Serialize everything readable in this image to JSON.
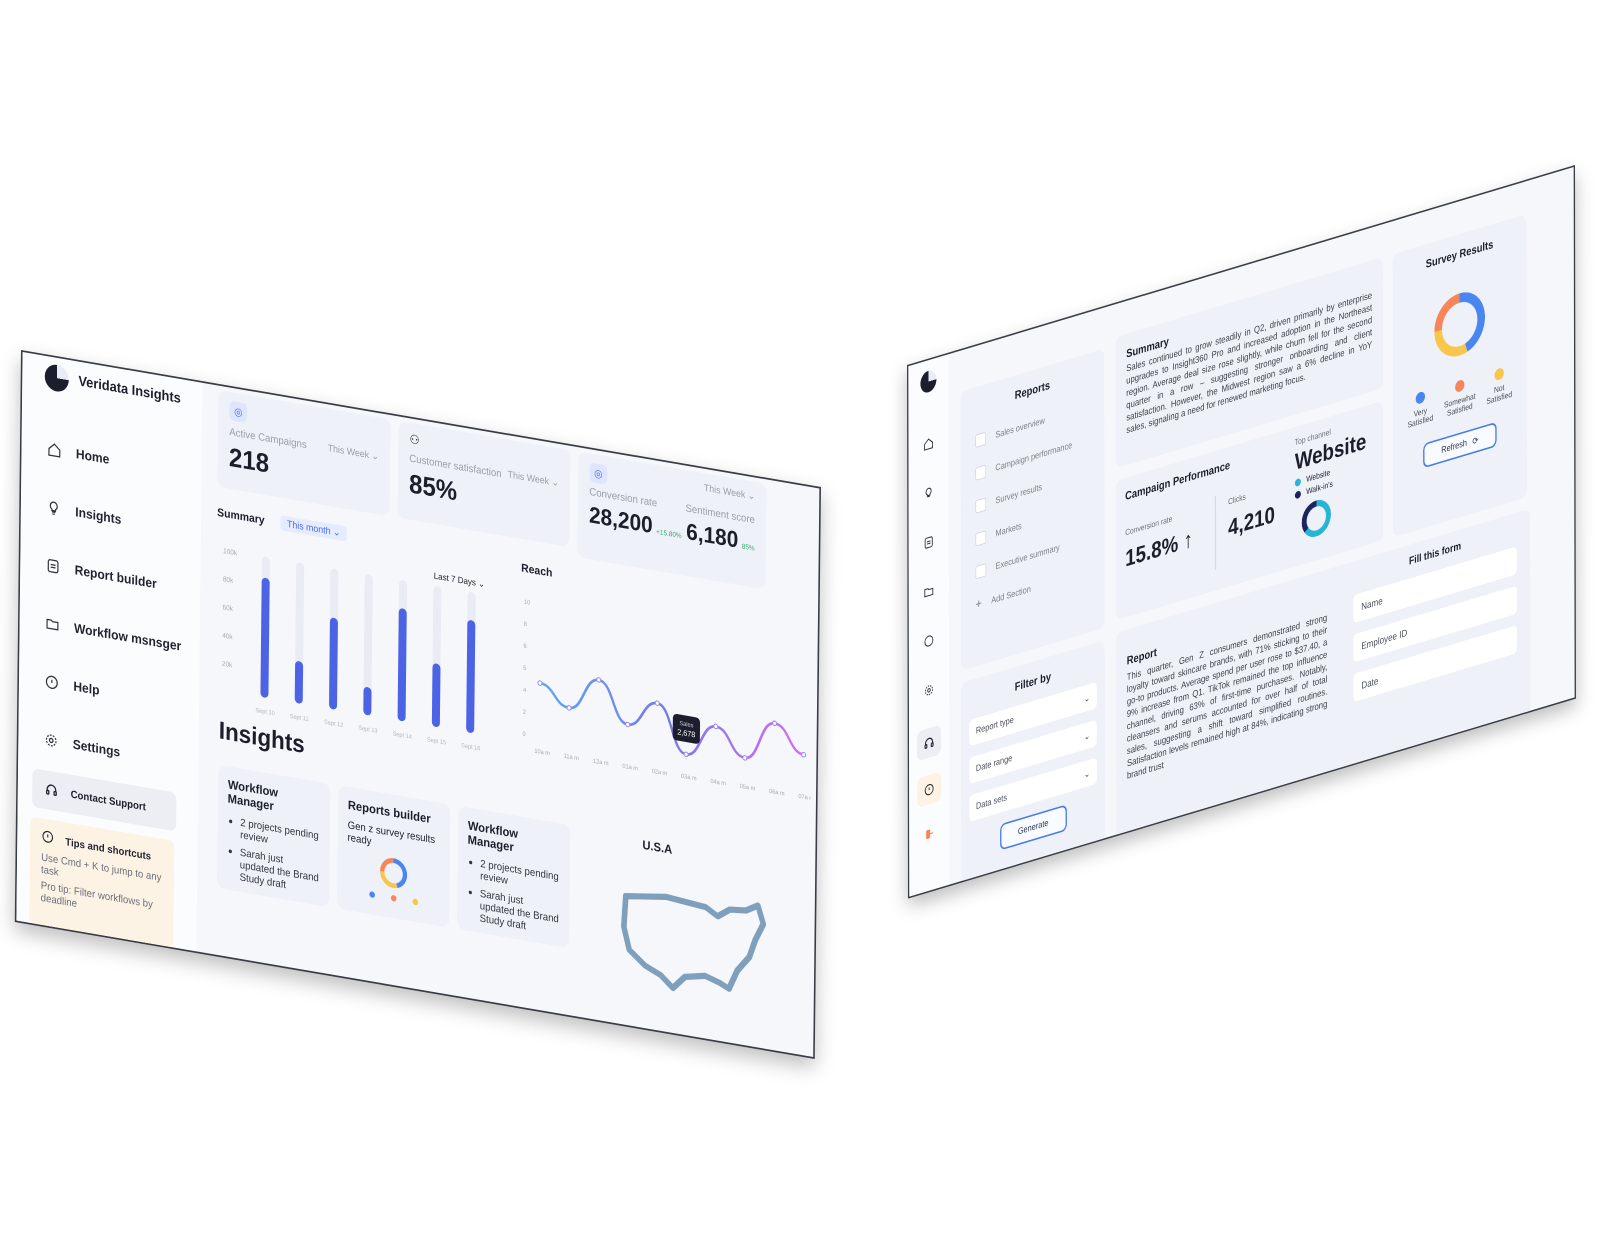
{
  "left_screen": {
    "brand": "Veridata Insights",
    "nav": [
      {
        "label": "Home",
        "icon": "home-icon"
      },
      {
        "label": "Insights",
        "icon": "lightbulb-icon"
      },
      {
        "label": "Report builder",
        "icon": "document-icon"
      },
      {
        "label": "Workflow msnsger",
        "icon": "folder-icon"
      },
      {
        "label": "Help",
        "icon": "info-icon"
      },
      {
        "label": "Settings",
        "icon": "gear-icon"
      }
    ],
    "contact_support": "Contact Support",
    "tips": {
      "title": "Tips and shortcuts",
      "line1": "Use Cmd + K to jump to any task",
      "line2": "Pro tip: Filter workflows by deadline"
    },
    "kpis": {
      "active_campaigns": {
        "label": "Active Campaigns",
        "value": "218",
        "period": "This Week"
      },
      "customer_satisfaction": {
        "label": "Customer satisfaction",
        "value": "85%",
        "period": "This Week"
      },
      "conversion": {
        "label": "Conversion rate",
        "value": "28,200",
        "delta": "+15.80%",
        "period": "This Week"
      },
      "sentiment": {
        "label": "Sentiment score",
        "value": "6,180",
        "delta": "85%"
      }
    },
    "summary": {
      "title": "Summary",
      "period": "This month",
      "range": "Last 7 Days",
      "y_ticks": [
        "100k",
        "80k",
        "60k",
        "40k",
        "20k"
      ],
      "x_ticks": [
        "Sept 10",
        "Sept 11",
        "Sept 12",
        "Sept 13",
        "Sept 14",
        "Sept 15",
        "Sept 16"
      ]
    },
    "reach": {
      "title": "Reach",
      "y_ticks": [
        "10",
        "8",
        "6",
        "5",
        "4",
        "2",
        "0"
      ],
      "x_ticks": [
        "10a m",
        "11a m",
        "12a m",
        "01a m",
        "02a m",
        "03a m",
        "04a m",
        "05a m",
        "06a m",
        "07a m"
      ],
      "tooltip_label": "Sales",
      "tooltip_value": "2,678"
    },
    "insights_title": "Insights",
    "cards": {
      "workflow1": {
        "title": "Workflow Manager",
        "items": [
          "2 projects pending review",
          "Sarah just updated the Brand Study draft"
        ]
      },
      "reports": {
        "title": "Reports builder",
        "text": "Gen z survey results ready"
      },
      "workflow2": {
        "title": "Workflow Manager",
        "items": [
          "2 projects pending review",
          "Sarah just updated the Brand Study draft"
        ]
      },
      "map": {
        "title": "U.S.A"
      }
    }
  },
  "right_screen": {
    "reports": {
      "title": "Reports",
      "items": [
        "Sales overview",
        "Campaign performance",
        "Survey results",
        "Markets",
        "Executive summary"
      ],
      "add": "Add Section"
    },
    "filter": {
      "title": "Filter by",
      "options": [
        "Report type",
        "Date range",
        "Data sets"
      ],
      "button": "Generate"
    },
    "summary": {
      "title": "Summary",
      "text": "Sales continued to grow steadily in Q2, driven primarily by enterprise upgrades to Insight360 Pro and increased adoption in the Northeast region. Average deal size rose slightly, while churn fell for the second quarter in a row – suggesting stronger onboarding and client satisfaction. However, the Midwest region saw a 6% decline in YoY sales, signaling a need for renewed marketing focus."
    },
    "campaign": {
      "title": "Campaign Performance",
      "conversion_label": "Conversion rate",
      "conversion_value": "15.8%",
      "clicks_label": "Clicks",
      "clicks_value": "4,210",
      "top_channel_label": "Top channel",
      "top_channel_value": "Website",
      "legend": [
        "Website",
        "Walk-in's"
      ],
      "colors": {
        "website": "#26b5d6",
        "walkins": "#1d2560"
      }
    },
    "survey": {
      "title": "Survey Results",
      "legend": [
        {
          "label": "Very Satisfied",
          "color": "#4a86f0"
        },
        {
          "label": "Somewhat Satisfied",
          "color": "#f6855a"
        },
        {
          "label": "Not Satisfied",
          "color": "#f7c64a"
        }
      ],
      "button": "Refresh"
    },
    "report": {
      "title": "Report",
      "text": "This quarter, Gen Z consumers demonstrated strong loyalty toward skincare brands, with 71% sticking to their go-to products. Average spend per user rose to $37.40, a 9% increase from Q1. TikTok remained the top influence channel, driving 63% of first-time purchases. Notably, cleansers and serums accounted for over half of total sales, suggesting a shift toward simplified routines. Satisfaction levels remained high at 84%, indicating strong brand trust"
    },
    "form": {
      "title": "Fill this form",
      "fields": [
        "Name",
        "Employee ID",
        "Date"
      ]
    }
  },
  "chart_data": [
    {
      "type": "bar",
      "title": "Summary",
      "categories": [
        "Sept 10",
        "Sept 11",
        "Sept 12",
        "Sept 13",
        "Sept 14",
        "Sept 15",
        "Sept 16"
      ],
      "values": [
        85,
        30,
        65,
        20,
        80,
        45,
        80
      ],
      "ylim": [
        0,
        100
      ]
    },
    {
      "type": "line",
      "title": "Reach",
      "x": [
        "10a m",
        "11a m",
        "12a m",
        "01a m",
        "02a m",
        "03a m",
        "04a m",
        "05a m",
        "06a m",
        "07a m"
      ],
      "values": [
        4,
        2.5,
        5,
        2,
        4,
        0.5,
        3,
        1,
        4,
        2
      ],
      "ylim": [
        0,
        10
      ]
    }
  ]
}
